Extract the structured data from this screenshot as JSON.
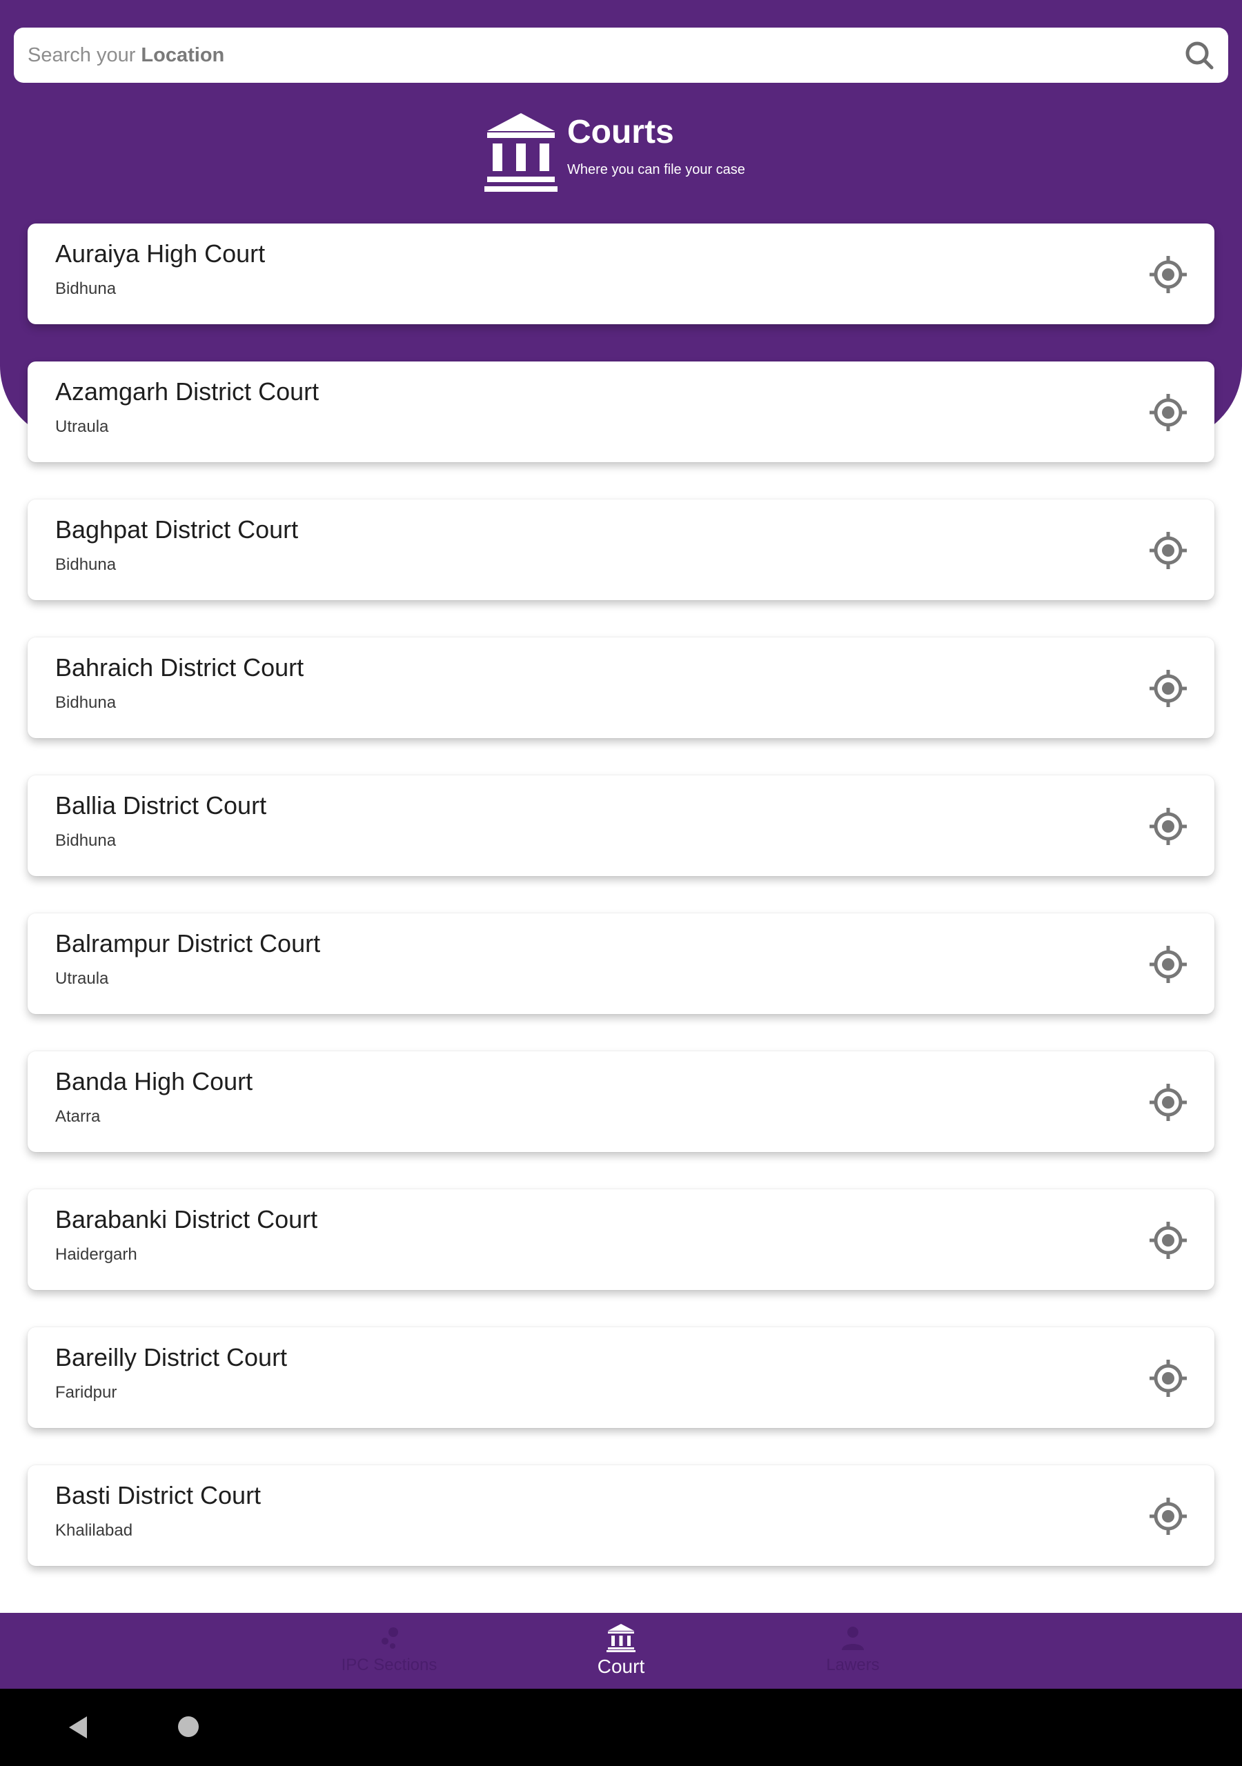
{
  "search": {
    "placeholder_prefix": "Search your ",
    "placeholder_bold": "Location"
  },
  "header": {
    "title": "Courts",
    "subtitle": "Where you can file your case"
  },
  "courts": [
    {
      "name": "Auraiya High Court",
      "city": "Bidhuna"
    },
    {
      "name": "Azamgarh District Court",
      "city": "Utraula"
    },
    {
      "name": "Baghpat District Court",
      "city": "Bidhuna"
    },
    {
      "name": "Bahraich District Court",
      "city": "Bidhuna"
    },
    {
      "name": "Ballia District Court",
      "city": "Bidhuna"
    },
    {
      "name": "Balrampur District Court",
      "city": "Utraula"
    },
    {
      "name": "Banda High Court",
      "city": "Atarra"
    },
    {
      "name": "Barabanki District Court",
      "city": "Haidergarh"
    },
    {
      "name": "Bareilly District Court",
      "city": "Faridpur"
    },
    {
      "name": "Basti District Court",
      "city": "Khalilabad"
    }
  ],
  "nav": {
    "items": [
      {
        "label": "IPC Sections",
        "icon": "scatter-dots-icon",
        "active": false
      },
      {
        "label": "Court",
        "icon": "courthouse-icon",
        "active": true
      },
      {
        "label": "Lawers",
        "icon": "person-icon",
        "active": false
      }
    ]
  },
  "colors": {
    "primary": "#58267c",
    "inactive_nav": "#4a1d6c",
    "locate_icon": "#777777"
  }
}
